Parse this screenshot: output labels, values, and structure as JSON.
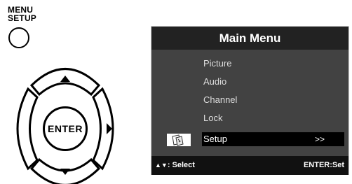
{
  "remote": {
    "menu_label": "MENU\nSETUP",
    "enter_label": "ENTER",
    "icons": [
      "up-arrow-icon",
      "down-arrow-icon",
      "right-arrow-icon"
    ]
  },
  "osd": {
    "title": "Main Menu",
    "items": [
      {
        "label": "Picture",
        "selected": false
      },
      {
        "label": "Audio",
        "selected": false
      },
      {
        "label": "Channel",
        "selected": false
      },
      {
        "label": "Lock",
        "selected": false
      },
      {
        "label": "Setup",
        "selected": true
      }
    ],
    "selected_indicator": ">>",
    "footer": {
      "select_symbols": "▲▼",
      "select_label": ": Select",
      "enter_label": "ENTER:Set"
    },
    "selected_icon": "setup-icon"
  },
  "colors": {
    "title_bg": "#222222",
    "body_bg": "#424242",
    "selected_bg": "#000000",
    "footer_bg": "#111111",
    "item_text": "#dddddd"
  }
}
